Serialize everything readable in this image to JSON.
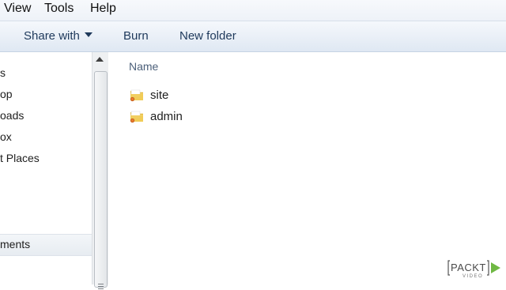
{
  "menu": {
    "items": [
      "View",
      "Tools",
      "Help"
    ]
  },
  "toolbar": {
    "share_with": "Share with",
    "burn": "Burn",
    "new_folder": "New folder"
  },
  "nav": {
    "items": [
      "s",
      "op",
      "oads",
      "ox",
      "t Places"
    ],
    "selected": "ments"
  },
  "content": {
    "column_header": "Name",
    "files": [
      {
        "name": "site",
        "icon": "folder-icon"
      },
      {
        "name": "admin",
        "icon": "folder-icon"
      }
    ]
  },
  "watermark": {
    "brand": "PACKT",
    "sub": "VIDEO"
  },
  "colors": {
    "toolbar_bg": "#e9eff7",
    "text_link": "#1e395b",
    "folder_yellow": "#e8c14a",
    "watermark_green": "#6fb843"
  }
}
